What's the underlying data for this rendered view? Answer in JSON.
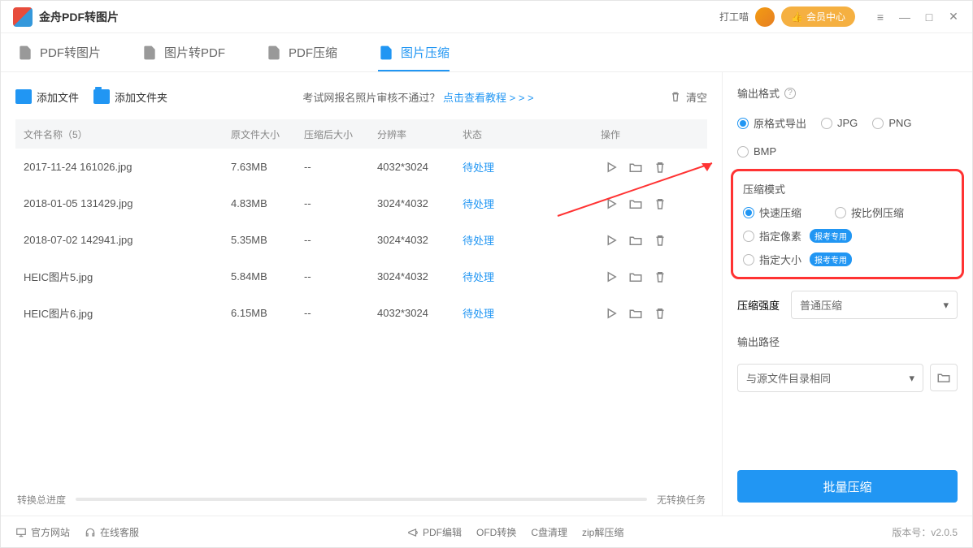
{
  "titlebar": {
    "app_title": "金舟PDF转图片",
    "username": "打工喵",
    "vip_label": "会员中心"
  },
  "tabs": [
    {
      "label": "PDF转图片",
      "active": false
    },
    {
      "label": "图片转PDF",
      "active": false
    },
    {
      "label": "PDF压缩",
      "active": false
    },
    {
      "label": "图片压缩",
      "active": true
    }
  ],
  "toolbar": {
    "add_file": "添加文件",
    "add_folder": "添加文件夹",
    "hint_prefix": "考试网报名照片审核不通过？",
    "hint_link": "点击查看教程 > > >",
    "clear": "清空"
  },
  "table": {
    "headers": {
      "name": "文件名称（5）",
      "osize": "原文件大小",
      "csize": "压缩后大小",
      "res": "分辨率",
      "status": "状态",
      "ops": "操作"
    },
    "rows": [
      {
        "name": "2017-11-24 161026.jpg",
        "osize": "7.63MB",
        "csize": "--",
        "res": "4032*3024",
        "status": "待处理"
      },
      {
        "name": "2018-01-05 131429.jpg",
        "osize": "4.83MB",
        "csize": "--",
        "res": "3024*4032",
        "status": "待处理"
      },
      {
        "name": "2018-07-02 142941.jpg",
        "osize": "5.35MB",
        "csize": "--",
        "res": "3024*4032",
        "status": "待处理"
      },
      {
        "name": "HEIC图片5.jpg",
        "osize": "5.84MB",
        "csize": "--",
        "res": "3024*4032",
        "status": "待处理"
      },
      {
        "name": "HEIC图片6.jpg",
        "osize": "6.15MB",
        "csize": "--",
        "res": "4032*3024",
        "status": "待处理"
      }
    ]
  },
  "progress": {
    "label": "转换总进度",
    "status": "无转换任务"
  },
  "side": {
    "format_title": "输出格式",
    "formats": [
      {
        "label": "原格式导出",
        "checked": true
      },
      {
        "label": "JPG",
        "checked": false
      },
      {
        "label": "PNG",
        "checked": false
      },
      {
        "label": "BMP",
        "checked": false
      }
    ],
    "mode_title": "压缩模式",
    "modes": [
      {
        "label": "快速压缩",
        "checked": true,
        "badge": ""
      },
      {
        "label": "按比例压缩",
        "checked": false,
        "badge": ""
      },
      {
        "label": "指定像素",
        "checked": false,
        "badge": "报考专用"
      },
      {
        "label": "指定大小",
        "checked": false,
        "badge": "报考专用"
      }
    ],
    "strength_label": "压缩强度",
    "strength_value": "普通压缩",
    "path_title": "输出路径",
    "path_value": "与源文件目录相同",
    "action_btn": "批量压缩"
  },
  "statusbar": {
    "site": "官方网站",
    "support": "在线客服",
    "links": [
      "PDF编辑",
      "OFD转换",
      "C盘清理",
      "zip解压缩"
    ],
    "version": "版本号：v2.0.5"
  }
}
